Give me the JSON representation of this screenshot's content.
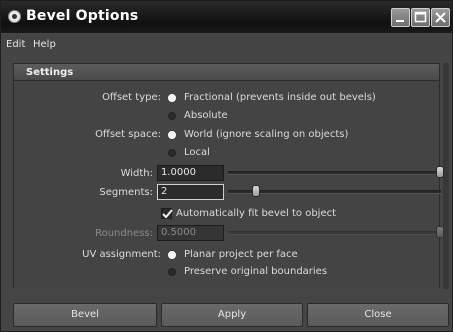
{
  "window": {
    "title": "Bevel Options"
  },
  "menu": {
    "items": [
      "Edit",
      "Help"
    ]
  },
  "settings": {
    "header": "Settings",
    "offset_type": {
      "label": "Offset type:",
      "options": [
        "Fractional (prevents inside out bevels)",
        "Absolute"
      ],
      "selected": 0
    },
    "offset_space": {
      "label": "Offset space:",
      "options": [
        "World (ignore scaling on objects)",
        "Local"
      ],
      "selected": 0
    },
    "width": {
      "label": "Width:",
      "value": "1.0000",
      "slider_fraction": 1.0
    },
    "segments": {
      "label": "Segments:",
      "value": "2",
      "slider_fraction": 0.1
    },
    "auto_fit": {
      "label": "Automatically fit bevel to object",
      "checked": true
    },
    "roundness": {
      "label": "Roundness:",
      "value": "0.5000",
      "slider_fraction": 1.0,
      "enabled": false
    },
    "uv_assignment": {
      "label": "UV assignment:",
      "options": [
        "Planar project per face",
        "Preserve original boundaries"
      ],
      "selected": 0
    }
  },
  "buttons": {
    "bevel": "Bevel",
    "apply": "Apply",
    "close": "Close"
  }
}
